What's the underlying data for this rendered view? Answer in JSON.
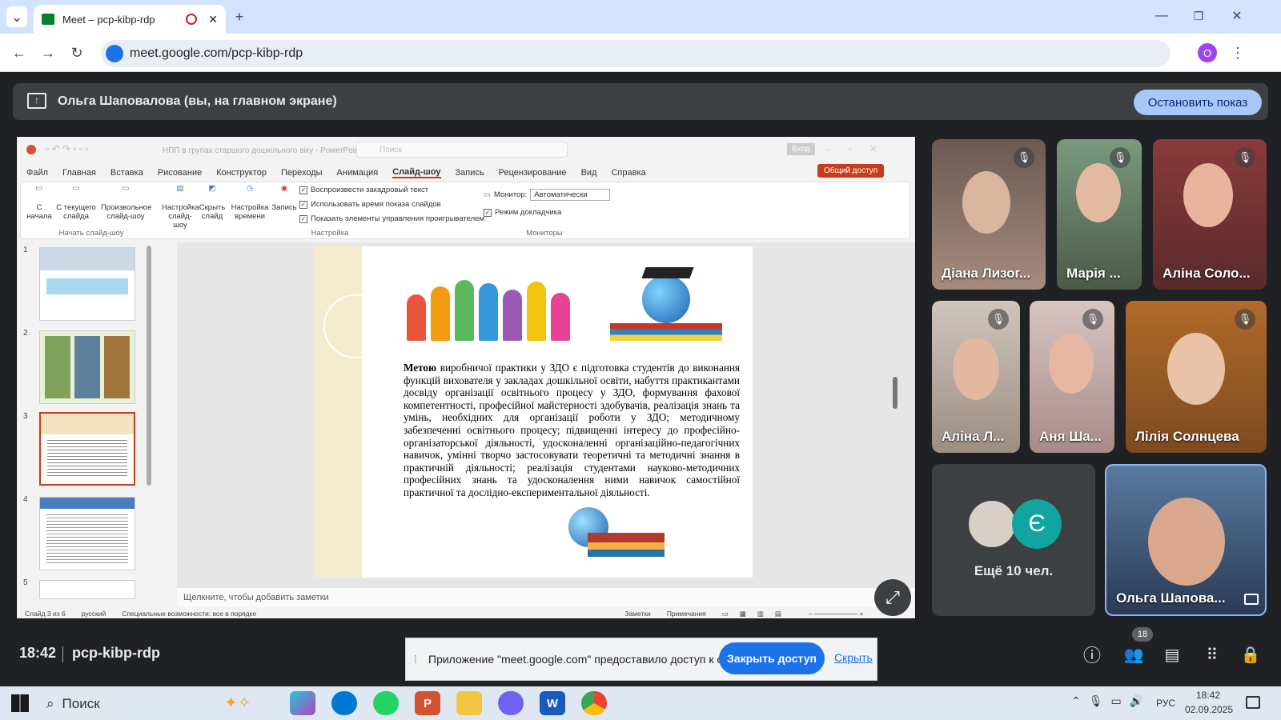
{
  "browser": {
    "tab_title": "Meet – pcp-kibp-rdp",
    "url": "meet.google.com/pcp-kibp-rdp",
    "profile_initial": "O"
  },
  "meet": {
    "presenter_text": "Ольга Шаповалова (вы, на главном экране)",
    "stop_button": "Остановить показ",
    "time": "18:42",
    "meeting_code": "pcp-kibp-rdp",
    "participants_count": "18",
    "more_people": "Ещё 10 чел.",
    "more_avatar_letter": "Є",
    "tiles": [
      {
        "name": "Діана Лизог..."
      },
      {
        "name": "Марія ..."
      },
      {
        "name": "Аліна Соло..."
      },
      {
        "name": "Аліна Л..."
      },
      {
        "name": "Аня Ша..."
      },
      {
        "name": "Лілія Солнцева"
      },
      {
        "name": "Ольга Шапова..."
      }
    ]
  },
  "ppt": {
    "title": "НПП в групах старшого дошкільного віку - PowerPoint",
    "search": "Поиск",
    "login": "Вход",
    "share": "Общий доступ",
    "menu": [
      "Файл",
      "Главная",
      "Вставка",
      "Рисование",
      "Конструктор",
      "Переходы",
      "Анимация",
      "Слайд-шоу",
      "Запись",
      "Рецензирование",
      "Вид",
      "Справка"
    ],
    "ribbon": {
      "from_start": "С начала",
      "from_current": "С текущего слайда",
      "custom": "Произвольное слайд-шоу",
      "group1": "Начать слайд-шоу",
      "setup": "Настройка слайд-шоу",
      "hide": "Скрыть слайд",
      "timing": "Настройка времени",
      "record": "Запись",
      "chk1": "Воспроизвести закадровый текст",
      "chk2": "Использовать время показа слайдов",
      "chk3": "Показать элементы управления проигрывателем",
      "group2": "Настройка",
      "monitor_label": "Монитор:",
      "monitor_value": "Автоматически",
      "presenter_view": "Режим докладчика",
      "group3": "Мониторы"
    },
    "thumb_numbers": [
      "1",
      "2",
      "3",
      "4",
      "5"
    ],
    "slide_bold": "Метою",
    "slide_text": " виробничої практики у ЗДО є підготовка студентів до виконання функцій вихователя у закладах дошкільної освіти, набуття практикантами досвіду організації освітнього процесу у ЗДО, формування фахової компетентності, професійної майстерності здобувачів, реалізація знань та умінь, необхідних для організації роботи у ЗДО; методичному забезпеченні освітнього процесу; підвищенні інтересу до професійно-організаторської діяльності, удосконаленні організаційно-педагогічних навичок, умінні творчо застосовувати теоретичні та методичні знання в практичній діяльності; реалізація студентами науково-методичних професійних знань та удосконалення ними навичок самостійної практичної та дослідно-експериментальної діяльності.",
    "notes": "Щелкните, чтобы добавить заметки",
    "status_slide": "Слайд 3 из 6",
    "status_lang": "русский",
    "status_access": "Специальные возможности: все в порядке",
    "status_notes": "Заметки",
    "status_comments": "Примечания"
  },
  "share_bar": {
    "text": "Приложение \"meet.google.com\" предоставило доступ к окну.",
    "close": "Закрыть доступ",
    "hide": "Скрыть"
  },
  "taskbar": {
    "search": "Поиск",
    "lang": "РУС",
    "time": "18:42",
    "date": "02.09.2025"
  }
}
